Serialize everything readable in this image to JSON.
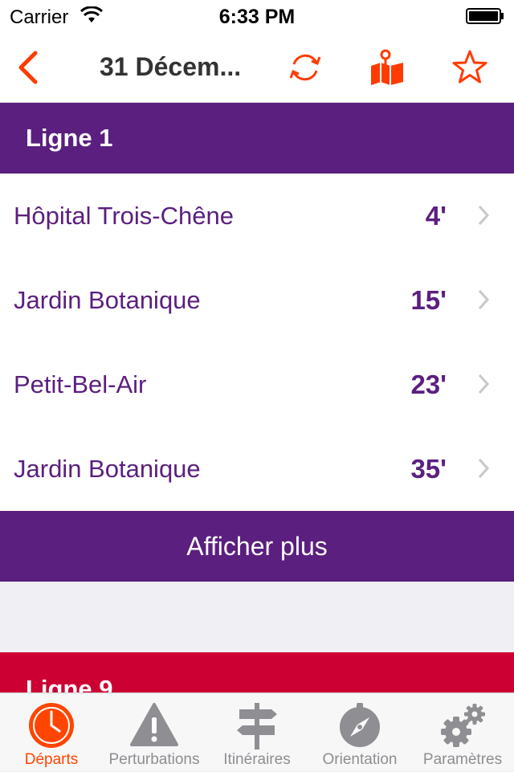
{
  "status_bar": {
    "carrier": "Carrier",
    "time": "6:33 PM"
  },
  "nav": {
    "title": "31 Décem..."
  },
  "sections": [
    {
      "title": "Ligne 1",
      "color": "#5b1f7f",
      "departures": [
        {
          "destination": "Hôpital Trois-Chêne",
          "time": "4'"
        },
        {
          "destination": "Jardin Botanique",
          "time": "15'"
        },
        {
          "destination": "Petit-Bel-Air",
          "time": "23'"
        },
        {
          "destination": "Jardin Botanique",
          "time": "35'"
        }
      ],
      "more_label": "Afficher plus"
    },
    {
      "title": "Ligne 9",
      "color": "#cc0033"
    }
  ],
  "tab_bar": {
    "items": [
      {
        "label": "Départs",
        "icon": "clock-icon",
        "active": true
      },
      {
        "label": "Perturbations",
        "icon": "warning-icon",
        "active": false
      },
      {
        "label": "Itinéraires",
        "icon": "signpost-icon",
        "active": false
      },
      {
        "label": "Orientation",
        "icon": "compass-icon",
        "active": false
      },
      {
        "label": "Paramètres",
        "icon": "gears-icon",
        "active": false
      }
    ]
  },
  "colors": {
    "accent": "#ff4500",
    "line1": "#5b1f7f",
    "line9": "#cc0033"
  }
}
